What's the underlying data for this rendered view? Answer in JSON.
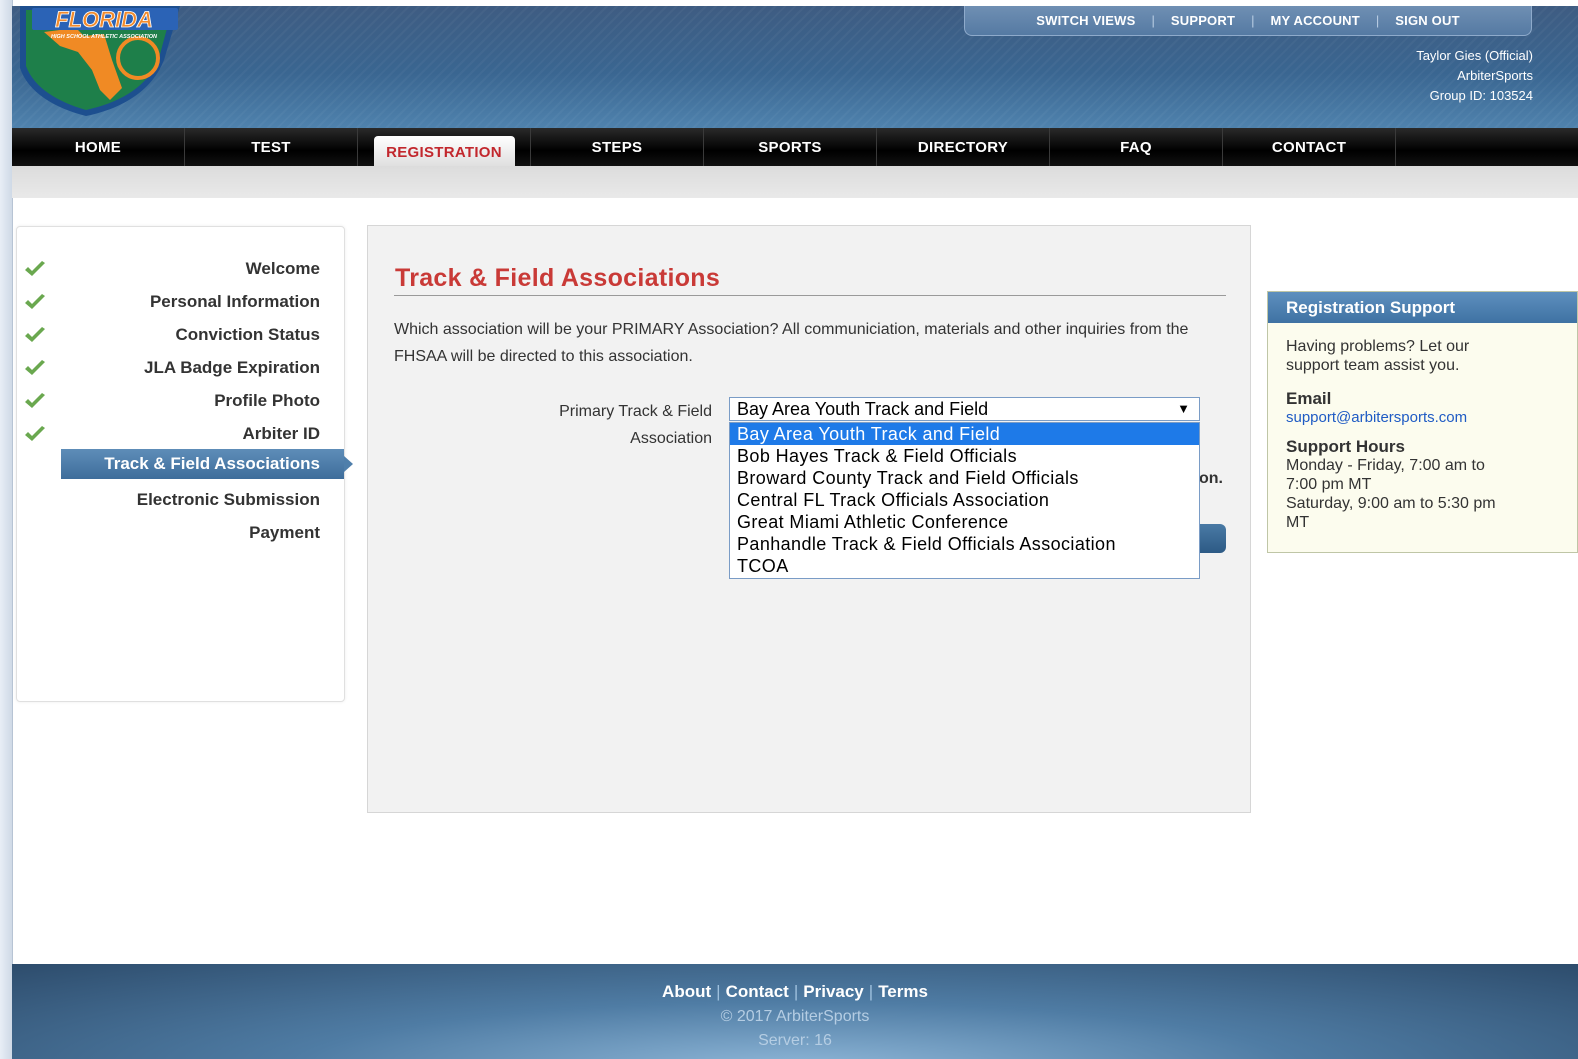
{
  "header": {
    "logo_text": "FLORIDA",
    "logo_subtext": "HIGH SCHOOL ATHLETIC ASSOCIATION",
    "utility_links": [
      "SWITCH VIEWS",
      "SUPPORT",
      "MY ACCOUNT",
      "SIGN OUT"
    ],
    "user_name": "Taylor Gies (Official)",
    "user_org": "ArbiterSports",
    "group_id": "Group ID: 103524"
  },
  "nav": {
    "tabs": [
      {
        "label": "HOME"
      },
      {
        "label": "TEST"
      },
      {
        "label": "REGISTRATION",
        "active": true
      },
      {
        "label": "STEPS"
      },
      {
        "label": "SPORTS"
      },
      {
        "label": "DIRECTORY"
      },
      {
        "label": "FAQ"
      },
      {
        "label": "CONTACT"
      }
    ]
  },
  "sidebar": {
    "steps": [
      {
        "label": "Welcome",
        "done": true
      },
      {
        "label": "Personal Information",
        "done": true
      },
      {
        "label": "Conviction Status",
        "done": true
      },
      {
        "label": "JLA Badge Expiration",
        "done": true
      },
      {
        "label": "Profile Photo",
        "done": true
      },
      {
        "label": "Arbiter ID",
        "done": true
      },
      {
        "label": "Track & Field Associations",
        "active": true
      },
      {
        "label": "Electronic Submission"
      },
      {
        "label": "Payment"
      }
    ]
  },
  "main": {
    "title": "Track & Field Associations",
    "intro": "Which association will be your PRIMARY Association? All communiciation, materials and other inquiries from the FHSAA will be directed to this association.",
    "field_label": "Primary Track & Field Association",
    "selected_value": "Bay Area Youth Track and Field",
    "options": [
      "Bay Area Youth Track and Field",
      "Bob Hayes Track & Field Officials",
      "Broward County Track and Field Officials",
      "Central FL Track Officials Association",
      "Great Miami Athletic Conference",
      "Panhandle Track & Field Officials Association",
      "TCOA"
    ],
    "partial_hidden_text": "on."
  },
  "support": {
    "title": "Registration Support",
    "intro": "Having problems? Let our support team assist you.",
    "email_label": "Email",
    "email": "support@arbitersports.com",
    "hours_label": "Support Hours",
    "hours_weekday": "Monday - Friday, 7:00 am to 7:00 pm MT",
    "hours_saturday": "Saturday, 9:00 am to 5:30 pm MT"
  },
  "footer": {
    "links": [
      "About",
      "Contact",
      "Privacy",
      "Terms"
    ],
    "copyright": "© 2017 ArbiterSports",
    "server": "Server: 16"
  },
  "colors": {
    "accent_red": "#c93a37",
    "nav_black": "#000000",
    "active_blue": "#3e6d9b",
    "selected_option": "#1e7ae8",
    "check_green": "#6aa84f"
  }
}
